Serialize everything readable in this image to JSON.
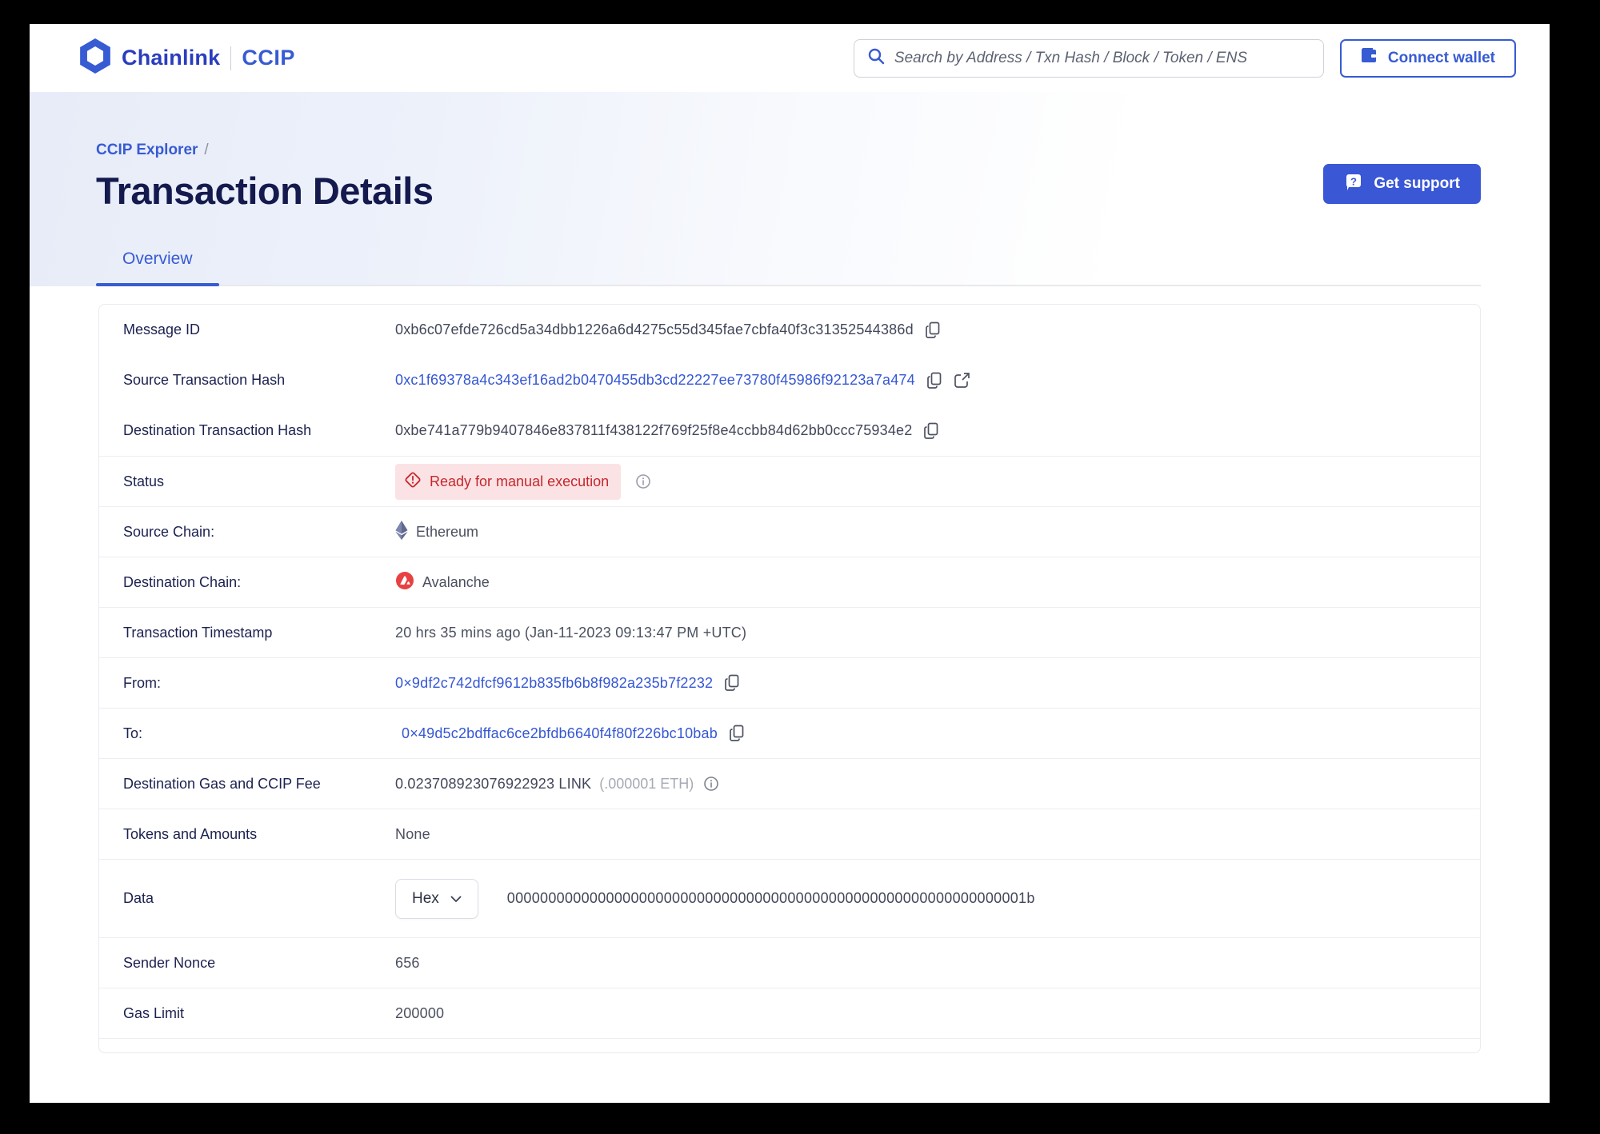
{
  "header": {
    "brand": "Chainlink",
    "product": "CCIP",
    "search": {
      "placeholder": "Search by Address / Txn Hash / Block / Token / ENS"
    },
    "connect_wallet_label": "Connect wallet"
  },
  "hero": {
    "breadcrumb": "CCIP Explorer",
    "breadcrumb_divider": "/",
    "title": "Transaction Details",
    "get_support_label": "Get support"
  },
  "tabs": {
    "overview": "Overview"
  },
  "details": {
    "message_id": {
      "label": "Message ID",
      "value": "0xb6c07efde726cd5a34dbb1226a6d4275c55d345fae7cbfa40f3c31352544386d"
    },
    "source_tx": {
      "label": "Source Transaction Hash",
      "value": "0xc1f69378a4c343ef16ad2b0470455db3cd22227ee73780f45986f92123a7a474"
    },
    "dest_tx": {
      "label": "Destination Transaction Hash",
      "value": "0xbe741a779b9407846e837811f438122f769f25f8e4ccbb84d62bb0ccc75934e2"
    },
    "status": {
      "label": "Status",
      "badge": "Ready for manual execution"
    },
    "source_chain": {
      "label": "Source Chain:",
      "value": "Ethereum"
    },
    "dest_chain": {
      "label": "Destination Chain:",
      "value": "Avalanche"
    },
    "timestamp": {
      "label": "Transaction Timestamp",
      "value": "20 hrs 35 mins ago (Jan-11-2023 09:13:47 PM +UTC)"
    },
    "from": {
      "label": "From:",
      "value": "0×9df2c742dfcf9612b835fb6b8f982a235b7f2232"
    },
    "to": {
      "label": "To:",
      "value": "0×49d5c2bdffac6ce2bfdb6640f4f80f226bc10bab"
    },
    "fee": {
      "label": "Destination Gas and CCIP Fee",
      "value": "0.023708923076922923 LINK",
      "eth_equiv": "(.000001 ETH)"
    },
    "tokens": {
      "label": "Tokens and Amounts",
      "value": "None"
    },
    "data": {
      "label": "Data",
      "format_selected": "Hex",
      "value": "000000000000000000000000000000000000000000000000000000000000001b"
    },
    "sender_nonce": {
      "label": "Sender Nonce",
      "value": "656"
    },
    "gas_limit": {
      "label": "Gas Limit",
      "value": "200000"
    }
  },
  "colors": {
    "accent_blue": "#375bd2",
    "title_navy": "#141a4d",
    "label_navy": "#1b2150",
    "value_gray": "#4b505f",
    "badge_bg": "#fbe3e5",
    "badge_text": "#c6262c",
    "avalanche_red": "#e84142",
    "ethereum_slate": "#62688f"
  }
}
